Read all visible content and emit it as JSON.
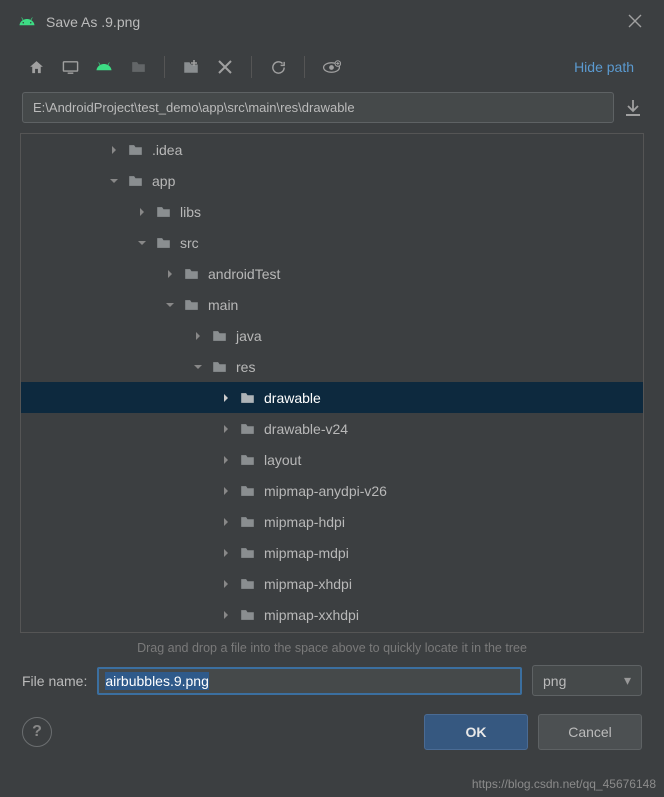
{
  "window": {
    "title": "Save As .9.png"
  },
  "toolbar": {
    "hide_path_label": "Hide path"
  },
  "path": {
    "value": "E:\\AndroidProject\\test_demo\\app\\src\\main\\res\\drawable"
  },
  "tree": {
    "items": [
      {
        "indent": 3,
        "expanded": false,
        "has_children": true,
        "label": ".idea",
        "selected": false
      },
      {
        "indent": 3,
        "expanded": true,
        "has_children": true,
        "label": "app",
        "selected": false
      },
      {
        "indent": 4,
        "expanded": false,
        "has_children": true,
        "label": "libs",
        "selected": false
      },
      {
        "indent": 4,
        "expanded": true,
        "has_children": true,
        "label": "src",
        "selected": false
      },
      {
        "indent": 5,
        "expanded": false,
        "has_children": true,
        "label": "androidTest",
        "selected": false
      },
      {
        "indent": 5,
        "expanded": true,
        "has_children": true,
        "label": "main",
        "selected": false
      },
      {
        "indent": 6,
        "expanded": false,
        "has_children": true,
        "label": "java",
        "selected": false
      },
      {
        "indent": 6,
        "expanded": true,
        "has_children": true,
        "label": "res",
        "selected": false
      },
      {
        "indent": 7,
        "expanded": false,
        "has_children": true,
        "label": "drawable",
        "selected": true
      },
      {
        "indent": 7,
        "expanded": false,
        "has_children": true,
        "label": "drawable-v24",
        "selected": false
      },
      {
        "indent": 7,
        "expanded": false,
        "has_children": true,
        "label": "layout",
        "selected": false
      },
      {
        "indent": 7,
        "expanded": false,
        "has_children": true,
        "label": "mipmap-anydpi-v26",
        "selected": false
      },
      {
        "indent": 7,
        "expanded": false,
        "has_children": true,
        "label": "mipmap-hdpi",
        "selected": false
      },
      {
        "indent": 7,
        "expanded": false,
        "has_children": true,
        "label": "mipmap-mdpi",
        "selected": false
      },
      {
        "indent": 7,
        "expanded": false,
        "has_children": true,
        "label": "mipmap-xhdpi",
        "selected": false
      },
      {
        "indent": 7,
        "expanded": false,
        "has_children": true,
        "label": "mipmap-xxhdpi",
        "selected": false
      }
    ]
  },
  "hint": "Drag and drop a file into the space above to quickly locate it in the tree",
  "filename": {
    "label": "File name:",
    "value": "airbubbles.9.png"
  },
  "ext": {
    "selected": "png"
  },
  "buttons": {
    "ok": "OK",
    "cancel": "Cancel",
    "help": "?"
  },
  "watermark": "https://blog.csdn.net/qq_45676148"
}
